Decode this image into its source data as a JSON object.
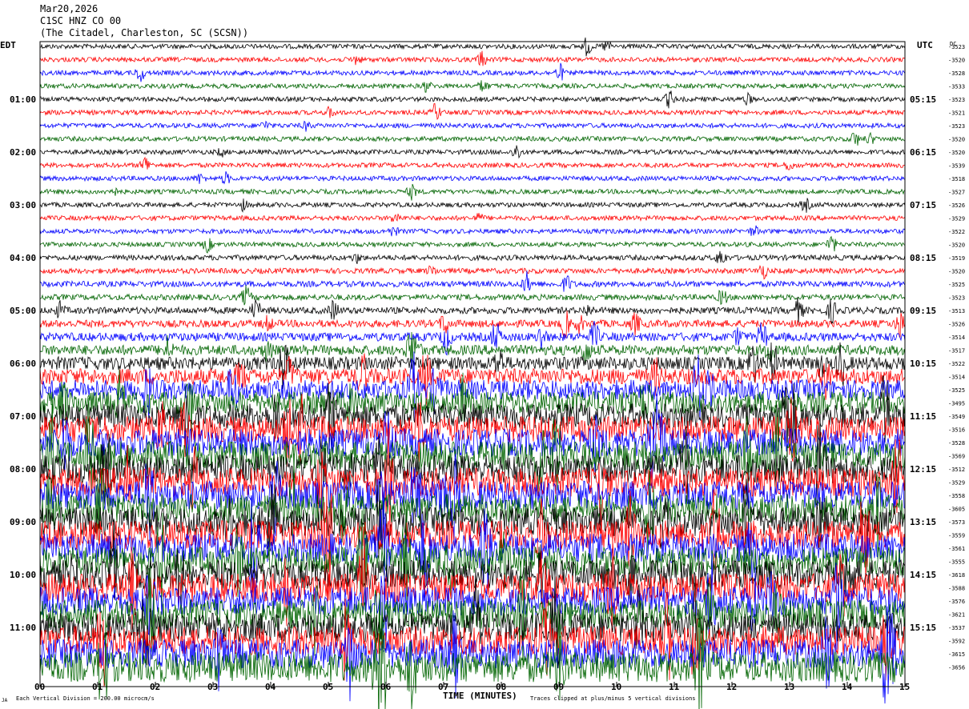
{
  "header": {
    "date": "Mar20,2026",
    "station": "C1SC HNZ CO 00",
    "location": "(The Citadel, Charleston, SC (SCSN))"
  },
  "labels": {
    "left_tz": "EDT",
    "right_tz": "UTC",
    "dc_label": "DC",
    "x_axis_title": "TIME (MINUTES)",
    "scale_note": "Each Vertical Division = 200.00 microcm/s",
    "clip_note": "Traces clipped at plus/minus 5 vertical divisions",
    "corner_mark": "JA"
  },
  "chart_data": {
    "type": "line",
    "x_ticks": [
      "00",
      "01",
      "02",
      "03",
      "04",
      "05",
      "06",
      "07",
      "08",
      "09",
      "10",
      "11",
      "12",
      "13",
      "14",
      "15"
    ],
    "x_range": [
      0,
      15
    ],
    "trace_colors": [
      "#000000",
      "#ff0000",
      "#0000ff",
      "#006400"
    ],
    "left_hour_labels": [
      "01:00",
      "02:00",
      "03:00",
      "04:00",
      "05:00",
      "06:00",
      "07:00",
      "08:00",
      "09:00",
      "10:00",
      "11:00"
    ],
    "right_hour_labels": [
      "05:15",
      "06:15",
      "07:15",
      "08:15",
      "09:15",
      "10:15",
      "11:15",
      "12:15",
      "13:15",
      "14:15",
      "15:15"
    ],
    "dc_offsets": [
      "-3523",
      "-3520",
      "-3528",
      "-3533",
      "-3523",
      "-3521",
      "-3523",
      "-3520",
      "-3520",
      "-3539",
      "-3518",
      "-3527",
      "-3526",
      "-3529",
      "-3522",
      "-3520",
      "-3519",
      "-3520",
      "-3525",
      "-3523",
      "-3513",
      "-3526",
      "-3514",
      "-3517",
      "-3522",
      "-3514",
      "-3525",
      "-3495",
      "-3549",
      "-3516",
      "-3528",
      "-3569",
      "-3512",
      "-3529",
      "-3558",
      "-3605",
      "-3573",
      "-3559",
      "-3561",
      "-3555",
      "-3618",
      "-3588",
      "-3576",
      "-3621",
      "-3537",
      "-3592",
      "-3615",
      "-3656"
    ],
    "trace_amplitude": [
      0.18,
      0.18,
      0.18,
      0.18,
      0.18,
      0.18,
      0.18,
      0.18,
      0.18,
      0.18,
      0.18,
      0.18,
      0.18,
      0.18,
      0.18,
      0.18,
      0.2,
      0.2,
      0.22,
      0.22,
      0.25,
      0.28,
      0.32,
      0.38,
      0.5,
      0.6,
      0.75,
      0.85,
      0.95,
      1.0,
      1.05,
      1.1,
      1.1,
      1.1,
      1.1,
      1.1,
      1.1,
      1.1,
      1.1,
      1.1,
      1.1,
      1.1,
      1.1,
      1.1,
      1.1,
      1.1,
      1.1,
      1.15
    ]
  }
}
